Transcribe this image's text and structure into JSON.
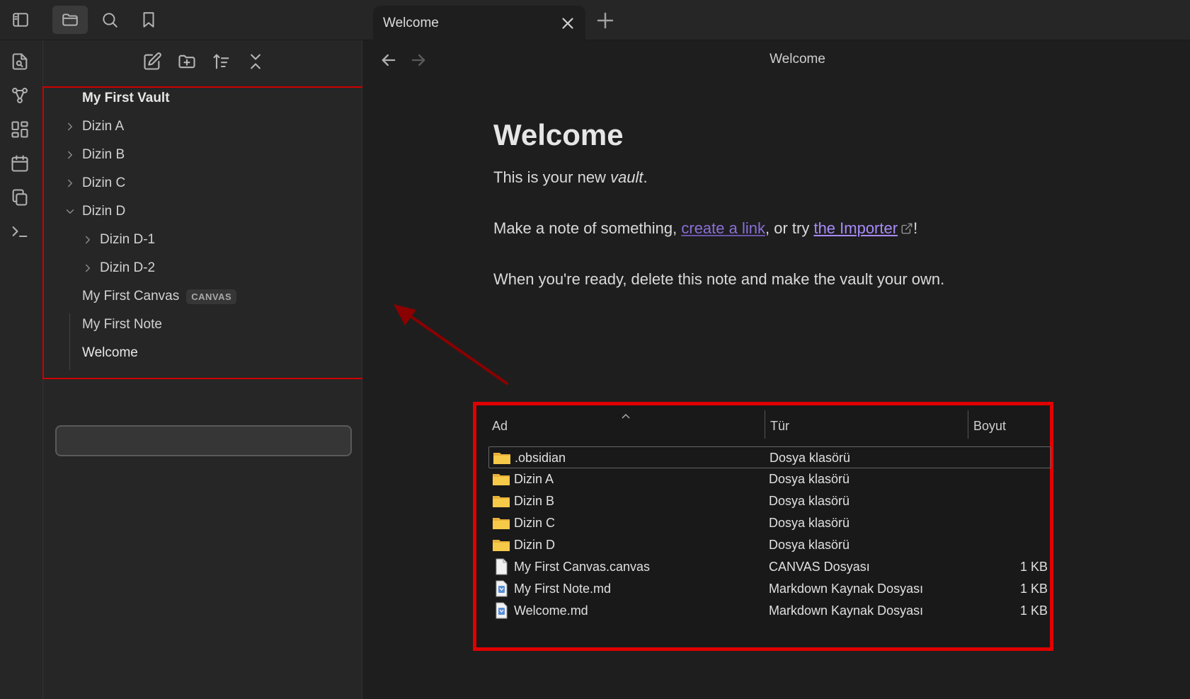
{
  "tab": {
    "label": "Welcome"
  },
  "view": {
    "title": "Welcome"
  },
  "sidebar": {
    "vault_name": "My First Vault",
    "items": [
      {
        "label": "Dizin A",
        "state": "collapsed"
      },
      {
        "label": "Dizin B",
        "state": "collapsed"
      },
      {
        "label": "Dizin C",
        "state": "collapsed"
      },
      {
        "label": "Dizin D",
        "state": "expanded"
      },
      {
        "label": "Dizin D-1",
        "state": "collapsed"
      },
      {
        "label": "Dizin D-2",
        "state": "collapsed"
      },
      {
        "label": "My First Canvas",
        "badge": "CANVAS"
      },
      {
        "label": "My First Note"
      },
      {
        "label": "Welcome",
        "selected": true
      }
    ]
  },
  "note": {
    "heading": "Welcome",
    "p1_prefix": "This is your new ",
    "p1_em": "vault",
    "p1_suffix": ".",
    "p2_prefix": "Make a note of something, ",
    "p2_link_internal": "create a link",
    "p2_middle": ", or try ",
    "p2_link_external": "the Importer",
    "p2_suffix": "!",
    "p3": "When you're ready, delete this note and make the vault your own."
  },
  "explorer": {
    "columns": {
      "name": "Ad",
      "type": "Tür",
      "size": "Boyut"
    },
    "rows": [
      {
        "name": ".obsidian",
        "type": "Dosya klasörü",
        "size": "",
        "icon": "folder-icon"
      },
      {
        "name": "Dizin A",
        "type": "Dosya klasörü",
        "size": "",
        "icon": "folder-icon"
      },
      {
        "name": "Dizin B",
        "type": "Dosya klasörü",
        "size": "",
        "icon": "folder-icon"
      },
      {
        "name": "Dizin C",
        "type": "Dosya klasörü",
        "size": "",
        "icon": "folder-icon"
      },
      {
        "name": "Dizin D",
        "type": "Dosya klasörü",
        "size": "",
        "icon": "folder-icon"
      },
      {
        "name": "My First Canvas.canvas",
        "type": "CANVAS Dosyası",
        "size": "1 KB",
        "icon": "file-icon"
      },
      {
        "name": "My First Note.md",
        "type": "Markdown Kaynak Dosyası",
        "size": "1 KB",
        "icon": "markdown-file-icon"
      },
      {
        "name": "Welcome.md",
        "type": "Markdown Kaynak Dosyası",
        "size": "1 KB",
        "icon": "markdown-file-icon"
      }
    ]
  },
  "colors": {
    "highlight_border": "#e00000",
    "arrow": "#8b0000",
    "internal_link": "#8b6fd8",
    "external_link": "#a88bfa",
    "folder": "#f4c542"
  }
}
